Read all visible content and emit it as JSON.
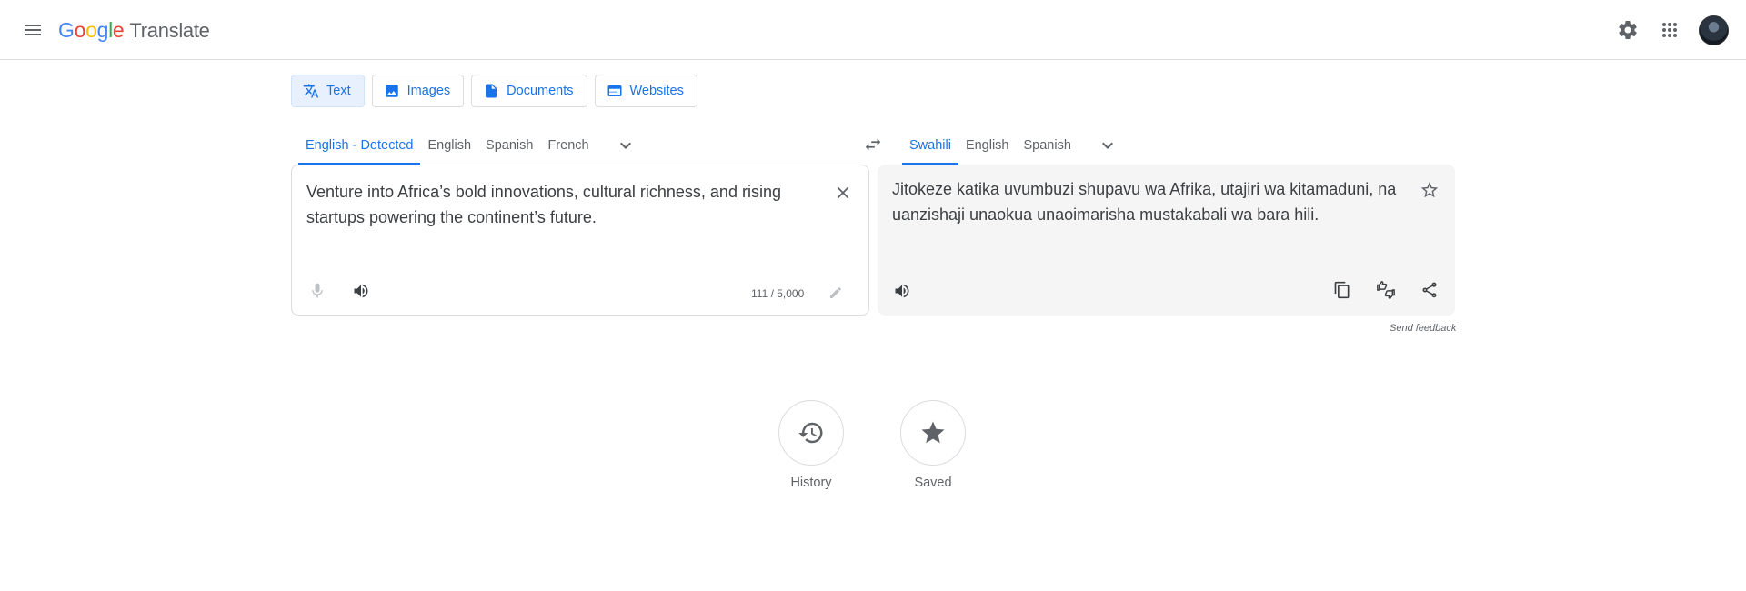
{
  "header": {
    "logo_letters": [
      "G",
      "o",
      "o",
      "g",
      "l",
      "e"
    ],
    "product": "Translate",
    "icons": {
      "menu": "menu-icon",
      "settings": "gear-icon",
      "apps": "apps-grid-icon",
      "avatar": "account-avatar"
    }
  },
  "modes": [
    {
      "label": "Text",
      "icon": "translate-icon",
      "active": true
    },
    {
      "label": "Images",
      "icon": "image-icon",
      "active": false
    },
    {
      "label": "Documents",
      "icon": "document-icon",
      "active": false
    },
    {
      "label": "Websites",
      "icon": "website-icon",
      "active": false
    }
  ],
  "source": {
    "languages": [
      "English - Detected",
      "English",
      "Spanish",
      "French"
    ],
    "active_index": 0,
    "text": "Venture into Africa’s bold innovations, cultural richness, and rising startups powering the continent’s future.",
    "char_count": "111 / 5,000"
  },
  "target": {
    "languages": [
      "Swahili",
      "English",
      "Spanish"
    ],
    "active_index": 0,
    "text": "Jitokeze katika uvumbuzi shupavu wa Afrika, utajiri wa kitamaduni, na uanzishaji unaokua unaoimarisha mustakabali wa bara hili."
  },
  "send_feedback": "Send feedback",
  "history_label": "History",
  "saved_label": "Saved",
  "colors": {
    "accent": "#1a73e8",
    "target_bg": "#f5f5f5",
    "border": "#dadce0"
  }
}
